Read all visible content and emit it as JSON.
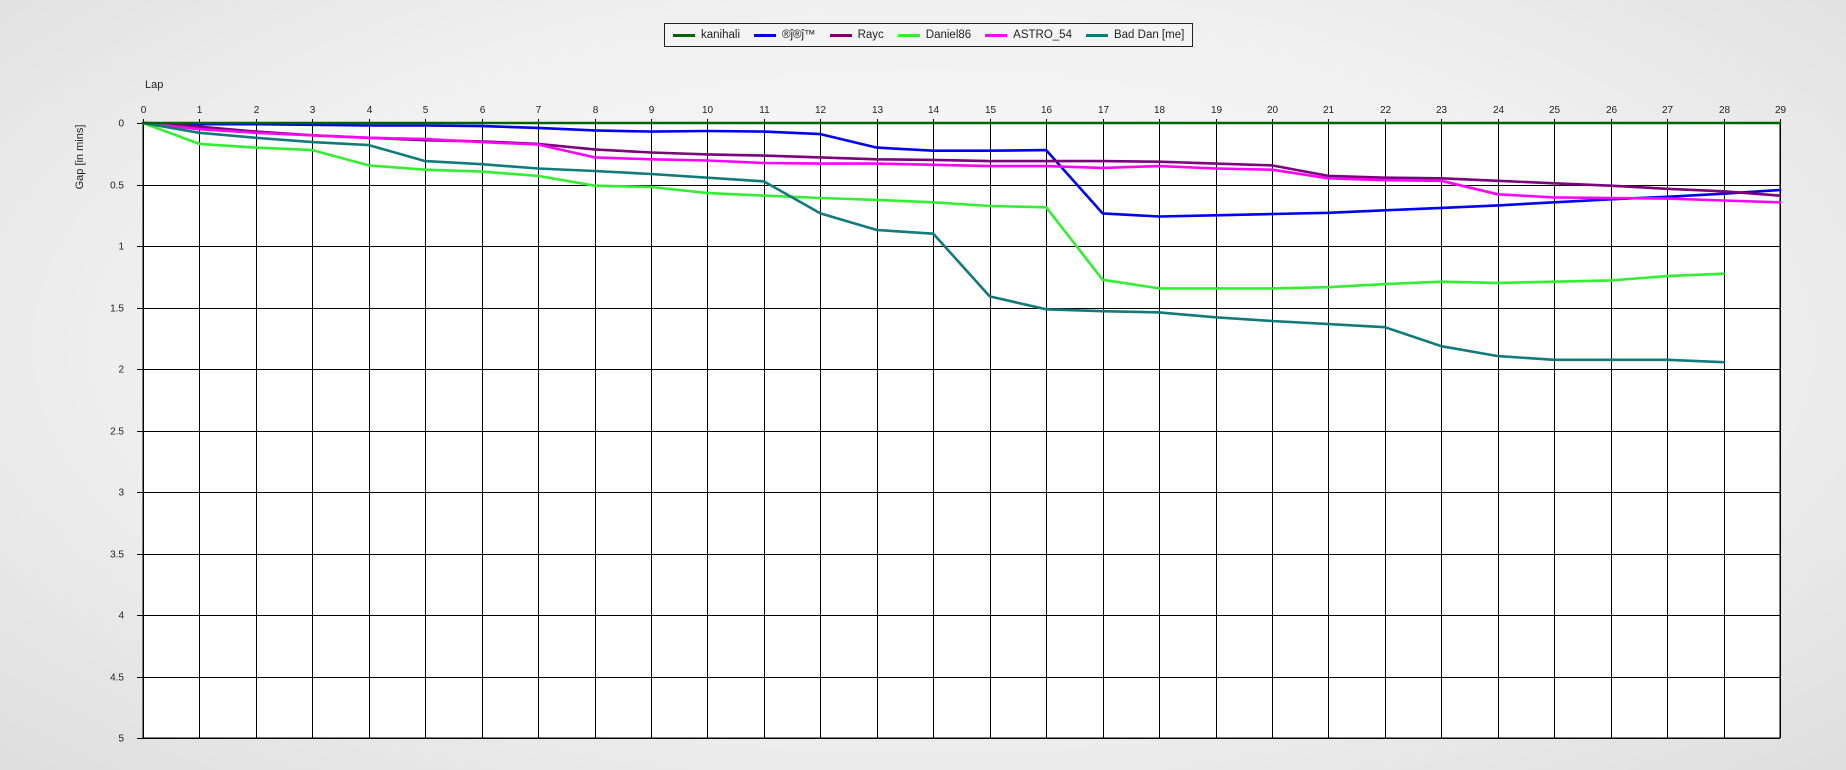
{
  "chart_data": {
    "type": "line",
    "xlabel": "Lap",
    "ylabel": "Gap [in mins]",
    "x": [
      0,
      1,
      2,
      3,
      4,
      5,
      6,
      7,
      8,
      9,
      10,
      11,
      12,
      13,
      14,
      15,
      16,
      17,
      18,
      19,
      20,
      21,
      22,
      23,
      24,
      25,
      26,
      27,
      28,
      29
    ],
    "xlim": [
      0,
      29
    ],
    "ylim": [
      0,
      5
    ],
    "y_inverted": true,
    "y_ticks": [
      "0",
      "0.5",
      "1",
      "1.5",
      "2",
      "2.5",
      "3",
      "3.5",
      "4",
      "4.5",
      "5"
    ],
    "grid": true,
    "legend_position": "top-center",
    "series": [
      {
        "name": "kanihali",
        "color": "#006400",
        "values": [
          0,
          0,
          0,
          0,
          0,
          0,
          0,
          0,
          0,
          0,
          0,
          0,
          0,
          0,
          0,
          0,
          0,
          0,
          0,
          0,
          0,
          0,
          0,
          0,
          0,
          0,
          0,
          0,
          0,
          0
        ]
      },
      {
        "name": "®ĵ®ĵ™",
        "color": "#0000ee",
        "values": [
          0,
          0.01,
          0.01,
          0.015,
          0.02,
          0.02,
          0.025,
          0.04,
          0.06,
          0.07,
          0.065,
          0.07,
          0.09,
          0.2,
          0.225,
          0.225,
          0.22,
          0.735,
          0.76,
          0.75,
          0.74,
          0.73,
          0.71,
          0.69,
          0.67,
          0.645,
          0.62,
          0.6,
          0.575,
          0.545
        ]
      },
      {
        "name": "Rayc",
        "color": "#7b007b",
        "values": [
          0,
          0.03,
          0.07,
          0.1,
          0.12,
          0.14,
          0.15,
          0.17,
          0.215,
          0.24,
          0.255,
          0.265,
          0.28,
          0.295,
          0.3,
          0.31,
          0.31,
          0.31,
          0.315,
          0.33,
          0.345,
          0.43,
          0.445,
          0.45,
          0.47,
          0.49,
          0.51,
          0.535,
          0.555,
          0.59
        ]
      },
      {
        "name": "Daniel86",
        "color": "#33ee33",
        "values": [
          0,
          0.17,
          0.2,
          0.22,
          0.345,
          0.38,
          0.395,
          0.43,
          0.51,
          0.52,
          0.57,
          0.59,
          0.61,
          0.625,
          0.645,
          0.675,
          0.685,
          1.275,
          1.345,
          1.345,
          1.345,
          1.335,
          1.31,
          1.29,
          1.3,
          1.29,
          1.28,
          1.245,
          1.225
        ]
      },
      {
        "name": "ASTRO_54",
        "color": "#ff00ff",
        "values": [
          0,
          0.05,
          0.08,
          0.1,
          0.12,
          0.13,
          0.155,
          0.175,
          0.28,
          0.295,
          0.305,
          0.325,
          0.33,
          0.33,
          0.34,
          0.35,
          0.35,
          0.365,
          0.35,
          0.37,
          0.38,
          0.45,
          0.465,
          0.47,
          0.58,
          0.605,
          0.61,
          0.615,
          0.63,
          0.645
        ]
      },
      {
        "name": "Bad Dan [me]",
        "color": "#117a7a",
        "values": [
          0,
          0.08,
          0.12,
          0.155,
          0.18,
          0.31,
          0.335,
          0.37,
          0.39,
          0.415,
          0.445,
          0.475,
          0.735,
          0.87,
          0.9,
          1.41,
          1.515,
          1.53,
          1.54,
          1.58,
          1.61,
          1.635,
          1.66,
          1.815,
          1.895,
          1.925,
          1.925,
          1.925,
          1.945
        ]
      }
    ]
  }
}
